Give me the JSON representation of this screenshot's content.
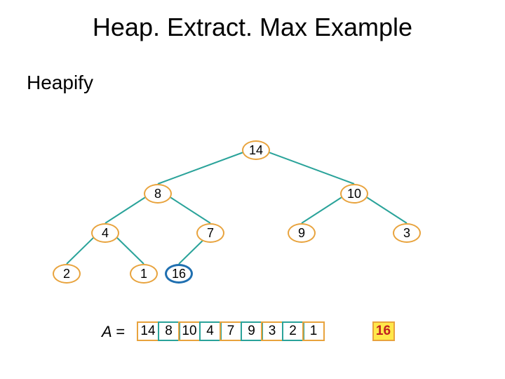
{
  "title": "Heap. Extract. Max Example",
  "subtitle": "Heapify",
  "tree": {
    "n0": "14",
    "n1": "8",
    "n2": "10",
    "n3": "4",
    "n4": "7",
    "n5": "9",
    "n6": "3",
    "n7": "2",
    "n8": "1",
    "n9": "16"
  },
  "array": {
    "label": "A =",
    "cells": [
      "14",
      "8",
      "10",
      "4",
      "7",
      "9",
      "3",
      "2",
      "1"
    ],
    "extracted": "16"
  },
  "chart_data": {
    "type": "tree",
    "title": "Heap.Extract.Max Example — Heapify",
    "nodes": [
      {
        "id": 0,
        "value": 14
      },
      {
        "id": 1,
        "value": 8
      },
      {
        "id": 2,
        "value": 10
      },
      {
        "id": 3,
        "value": 4
      },
      {
        "id": 4,
        "value": 7
      },
      {
        "id": 5,
        "value": 9
      },
      {
        "id": 6,
        "value": 3
      },
      {
        "id": 7,
        "value": 2
      },
      {
        "id": 8,
        "value": 1
      },
      {
        "id": 9,
        "value": 16,
        "highlighted": true
      }
    ],
    "edges": [
      [
        0,
        1
      ],
      [
        0,
        2
      ],
      [
        1,
        3
      ],
      [
        1,
        4
      ],
      [
        2,
        5
      ],
      [
        2,
        6
      ],
      [
        3,
        7
      ],
      [
        3,
        8
      ],
      [
        4,
        9
      ]
    ],
    "array": {
      "A": [
        14,
        8,
        10,
        4,
        7,
        9,
        3,
        2,
        1
      ],
      "extracted_max": 16
    }
  }
}
